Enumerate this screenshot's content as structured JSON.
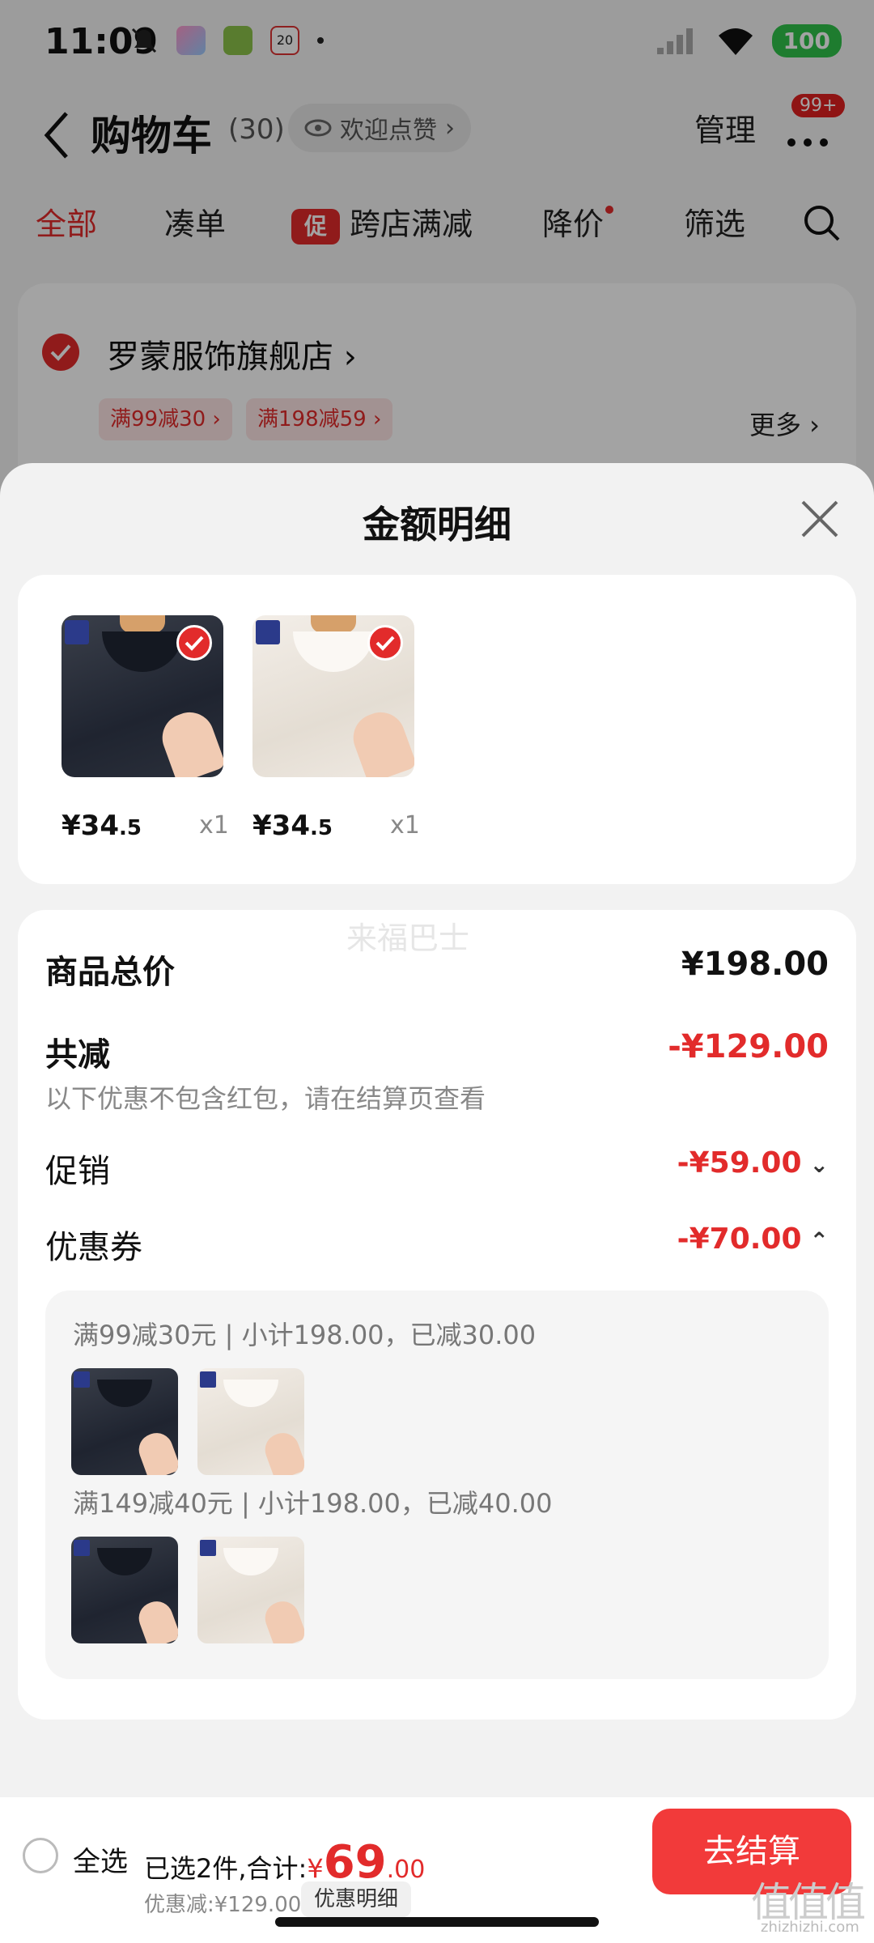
{
  "status": {
    "time": "11:09",
    "calendar_day": "20",
    "battery": "100"
  },
  "nav": {
    "title": "购物车",
    "count": "(30)",
    "welcome": "欢迎点赞",
    "manage": "管理",
    "badge": "99+"
  },
  "tabs": [
    {
      "label": "全部"
    },
    {
      "label": "凑单"
    },
    {
      "label": "跨店满减",
      "chip": "促"
    },
    {
      "label": "降价"
    },
    {
      "label": "筛选"
    }
  ],
  "store": {
    "name": "罗蒙服饰旗舰店",
    "coupons": [
      "满99减30 ›",
      "满198减59 ›"
    ],
    "more": "更多 ›"
  },
  "sheet": {
    "title": "金额明细",
    "products": [
      {
        "price": "¥34",
        "price_dec": ".5",
        "qty": "x1",
        "variant": "dark"
      },
      {
        "price": "¥34",
        "price_dec": ".5",
        "qty": "x1",
        "variant": "light"
      }
    ],
    "watermark": "来福巴士",
    "total_label": "商品总价",
    "total_value": "¥198.00",
    "reduce_label": "共减",
    "reduce_value": "-¥129.00",
    "note": "以下优惠不包含红包，请在结算页查看",
    "promo_label": "促销",
    "promo_value": "-¥59.00",
    "coupon_label": "优惠券",
    "coupon_value": "-¥70.00",
    "coupon_rules": [
      {
        "text": "满99减30元 | 小计198.00，已减30.00"
      },
      {
        "text": "满149减40元 | 小计198.00，已减40.00"
      }
    ]
  },
  "bottom": {
    "select_all": "全选",
    "summary_prefix": "已选2件,合计:",
    "currency": "¥",
    "total_int": "69",
    "total_dec": ".00",
    "discount": "优惠减:¥129.00",
    "detail_chip": "优惠明细",
    "checkout": "去结算",
    "corner_mark": "值值值",
    "corner_sub": "zhizhizhi.com"
  },
  "colors": {
    "accent": "#e22b2b",
    "checkout": "#f23a3a",
    "battery": "#2fc24a"
  }
}
